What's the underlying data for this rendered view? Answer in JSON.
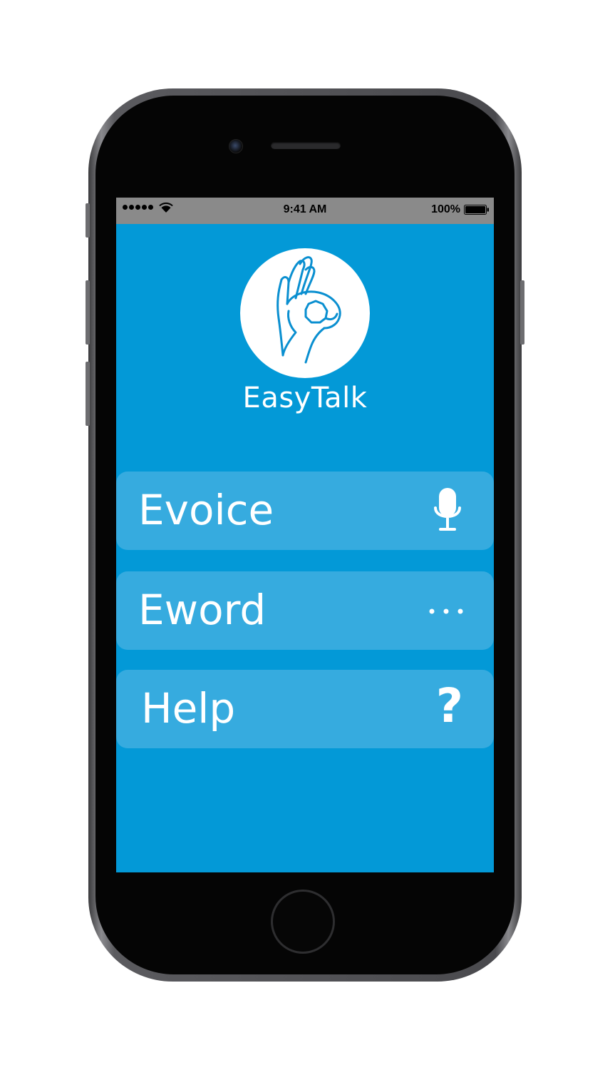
{
  "status_bar": {
    "time": "9:41 AM",
    "battery": "100%",
    "signal_icon": "signal-dots-icon",
    "wifi_icon": "wifi-icon",
    "battery_icon": "battery-full-icon"
  },
  "app": {
    "title": "EasyTalk",
    "logo_icon": "ok-hand-gesture-icon"
  },
  "menu": {
    "items": [
      {
        "label": "Evoice",
        "icon": "microphone-icon"
      },
      {
        "label": "Eword",
        "icon": "more-dots-icon"
      },
      {
        "label": "Help",
        "icon": "question-mark-icon",
        "glyph": "?"
      }
    ]
  },
  "colors": {
    "screen_background": "#0399d7",
    "button_background": "#36abdf",
    "status_bar": "#8a8a8a",
    "text": "#ffffff",
    "logo_stroke": "#0a8fd0"
  }
}
